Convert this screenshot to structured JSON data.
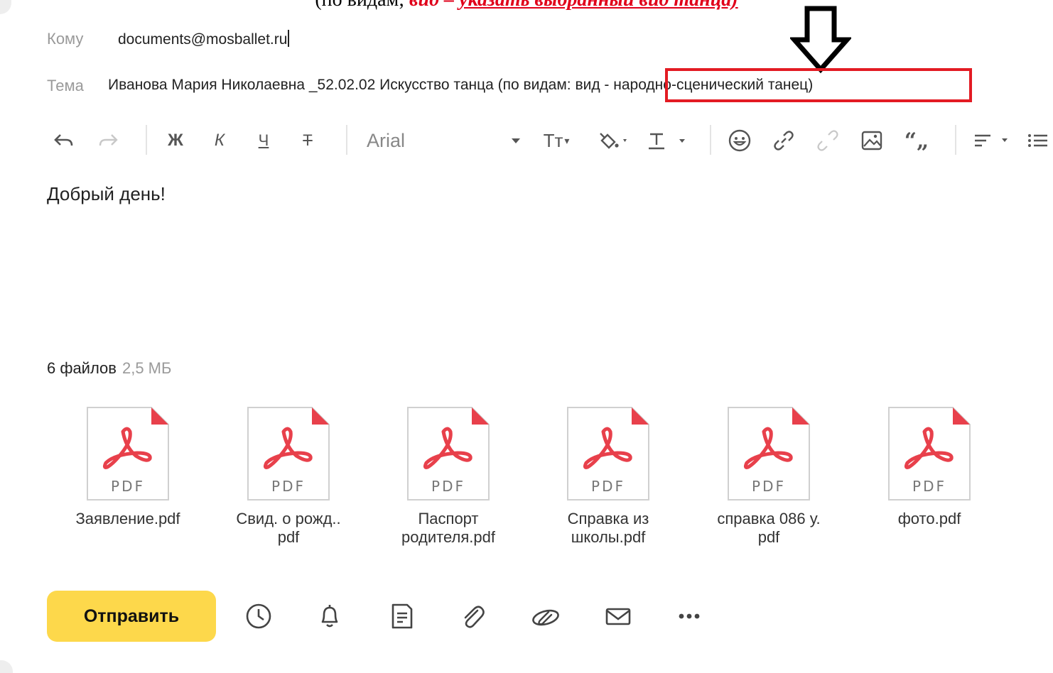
{
  "doc_caption": {
    "prefix": "(по видам; ",
    "red1": "вид",
    "dash": " – ",
    "red2": "указать выбранный вид танца)"
  },
  "compose": {
    "to_label": "Кому",
    "to_value": "documents@mosballet.ru",
    "subject_label": "Тема",
    "subject_value": "Иванова Мария Николаевна _52.02.02 Искусство танца (по видам: вид - народно-сценический танец)",
    "font_name": "Arial",
    "body_text": "Добрый день!"
  },
  "toolbar": {
    "bold": "Ж",
    "italic": "К",
    "underline": "Ч",
    "strike": "Т",
    "font_size": "Тт"
  },
  "attachments": {
    "count_label": "6 файлов",
    "size_label": "2,5 МБ",
    "icon_label": "PDF",
    "files": [
      {
        "line1": "Заявление.pdf",
        "line2": ""
      },
      {
        "line1": "Свид. о рожд..",
        "line2": "pdf"
      },
      {
        "line1": "Паспорт",
        "line2": "родителя.pdf"
      },
      {
        "line1": "Справка из",
        "line2": "школы.pdf"
      },
      {
        "line1": "справка 086 у.",
        "line2": "pdf"
      },
      {
        "line1": "фото.pdf",
        "line2": ""
      }
    ]
  },
  "actions": {
    "send_label": "Отправить"
  },
  "colors": {
    "accent": "#fdd84b",
    "highlight": "#e31b23",
    "pdf_red": "#e8404b"
  }
}
